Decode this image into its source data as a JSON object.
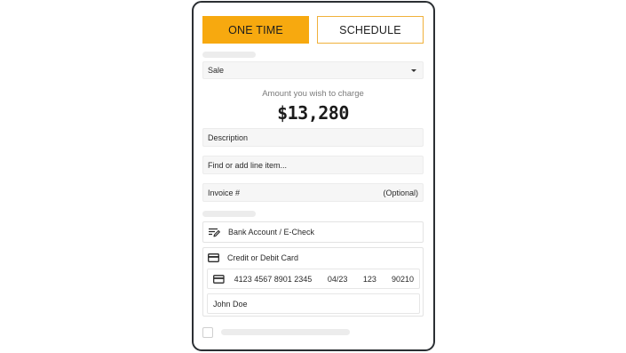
{
  "tabs": {
    "one_time": "ONE TIME",
    "schedule": "SCHEDULE"
  },
  "transaction_type": {
    "value": "Sale"
  },
  "amount": {
    "label": "Amount you wish to charge",
    "value": "$13,280"
  },
  "description": {
    "placeholder": "Description"
  },
  "line_item": {
    "placeholder": "Find or add line item..."
  },
  "invoice": {
    "label": "Invoice #",
    "hint": "(Optional)"
  },
  "payment_methods": {
    "bank": {
      "label": "Bank Account / E-Check",
      "icon": "edit-document-icon"
    },
    "card": {
      "label": "Credit or Debit Card",
      "icon": "credit-card-icon"
    }
  },
  "card_details": {
    "number": "4123 4567 8901 2345",
    "expiry": "04/23",
    "cvv": "123",
    "zip": "90210"
  },
  "cardholder": {
    "name": "John Doe"
  },
  "colors": {
    "accent": "#f7a90f",
    "border": "#2b2f33"
  }
}
